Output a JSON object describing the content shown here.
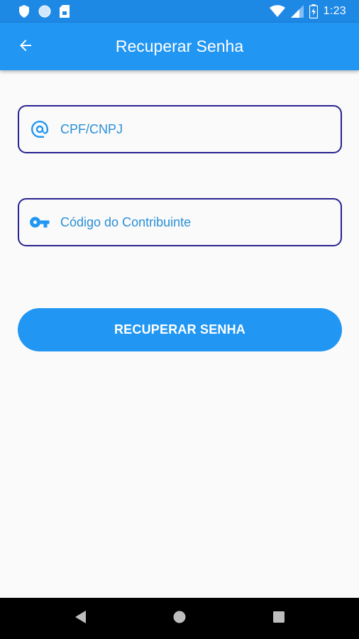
{
  "status_bar": {
    "time": "1:23",
    "icons": [
      "shield-icon",
      "circle-icon",
      "sim-card-icon",
      "wifi-icon",
      "signal-icon",
      "battery-charging-icon"
    ]
  },
  "app_bar": {
    "back_icon": "arrow-back-icon",
    "title": "Recuperar Senha"
  },
  "form": {
    "cpf": {
      "icon": "at-sign-icon",
      "placeholder": "CPF/CNPJ",
      "value": ""
    },
    "code": {
      "icon": "key-icon",
      "placeholder": "Código do Contribuinte",
      "value": ""
    },
    "submit_label": "RECUPERAR SENHA"
  },
  "colors": {
    "app_bar": "#2196f3",
    "status_bar": "#1e88e5",
    "input_border": "#28238f",
    "accent": "#2196f3",
    "background": "#fafafa"
  },
  "nav_bar": {
    "icons": [
      "nav-back-icon",
      "nav-home-icon",
      "nav-recents-icon"
    ]
  }
}
